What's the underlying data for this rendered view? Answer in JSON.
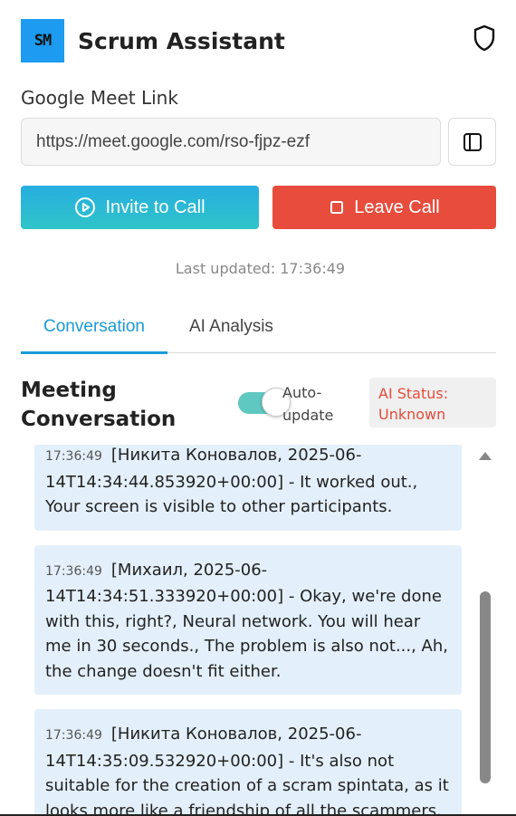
{
  "app": {
    "logo_text": "SM",
    "title": "Scrum Assistant",
    "icons": {
      "right": "shield-icon",
      "side_button": "sidebar-panel-icon"
    }
  },
  "meet": {
    "label": "Google Meet Link",
    "link_value": "https://meet.google.com/rso-fjpz-ezf"
  },
  "actions": {
    "invite_label": "Invite to Call",
    "invite_icon": "play-circle-icon",
    "leave_label": "Leave Call",
    "leave_icon": "stop-square-icon"
  },
  "status": {
    "last_updated_label": "Last updated:",
    "last_updated_time": "17:36:49"
  },
  "tabs": [
    {
      "label": "Conversation",
      "active": true
    },
    {
      "label": "AI Analysis",
      "active": false
    }
  ],
  "conversation": {
    "title": "Meeting Conversation",
    "auto_update_label": "Auto-update",
    "auto_update_on": true,
    "ai_status": "AI Status: Unknown",
    "messages": [
      {
        "time": "17:36:49",
        "text": "[Никита Коновалов, 2025-06-14T14:34:44.853920+00:00] - It worked out., Your screen is visible to other participants."
      },
      {
        "time": "17:36:49",
        "text": "[Михаил, 2025-06-14T14:34:51.333920+00:00] - Okay, we're done with this, right?, Neural network. You will hear me in 30 seconds., The problem is also not..., Ah, the change doesn't fit either."
      },
      {
        "time": "17:36:49",
        "text": "[Никита Коновалов, 2025-06-14T14:35:09.532920+00:00] - It's also not suitable for the creation of a scram spintata, as it looks more like a friendship of all the scammers."
      }
    ]
  },
  "colors": {
    "brand_blue": "#1d9bf0",
    "tab_active": "#1a9bd7",
    "leave_red": "#e74c3c",
    "toggle_teal": "#5fc8c0",
    "message_bg": "#e3f0fb"
  }
}
